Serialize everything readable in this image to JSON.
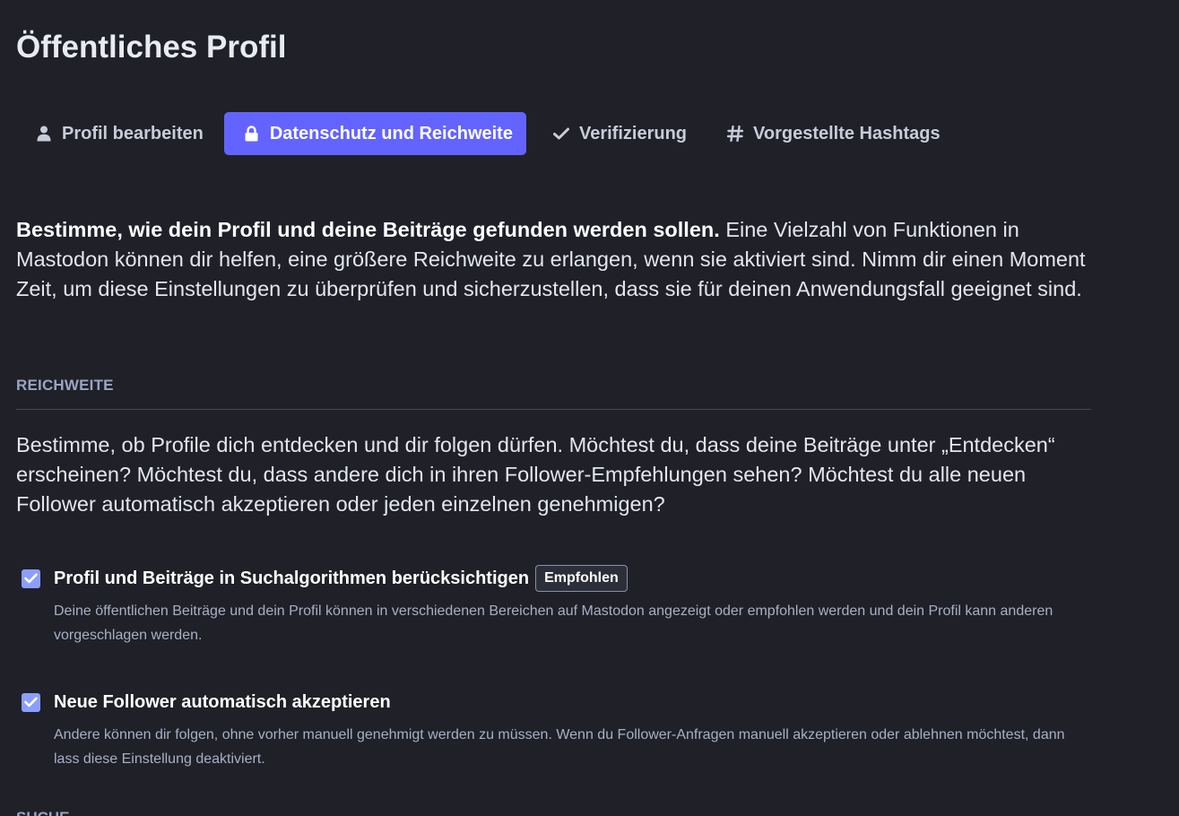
{
  "page": {
    "title": "Öffentliches Profil"
  },
  "tabs": [
    {
      "label": "Profil bearbeiten",
      "icon": "user-icon",
      "active": false
    },
    {
      "label": "Datenschutz und Reichweite",
      "icon": "lock-icon",
      "active": true
    },
    {
      "label": "Verifizierung",
      "icon": "check-icon",
      "active": false
    },
    {
      "label": "Vorgestellte Hashtags",
      "icon": "hashtag-icon",
      "active": false
    }
  ],
  "intro": {
    "bold": "Bestimme, wie dein Profil und deine Beiträge gefunden werden sollen.",
    "text": " Eine Vielzahl von Funktionen in Mastodon können dir helfen, eine größere Reichweite zu erlangen, wenn sie aktiviert sind. Nimm dir einen Moment Zeit, um diese Einstellungen zu überprüfen und sicherzustellen, dass sie für deinen Anwendungsfall geeignet sind."
  },
  "reach": {
    "heading": "REICHWEITE",
    "intro": "Bestimme, ob Profile dich entdecken und dir folgen dürfen. Möchtest du, dass deine Beiträge unter „Entdecken“ erscheinen? Möchtest du, dass andere dich in ihren Follower-Empfehlungen sehen? Möchtest du alle neuen Follower automatisch akzeptieren oder jeden einzelnen genehmigen?",
    "options": [
      {
        "label": "Profil und Beiträge in Suchalgorithmen berücksichtigen",
        "badge": "Empfohlen",
        "checked": true,
        "hint": "Deine öffentlichen Beiträge und dein Profil können in verschiedenen Bereichen auf Mastodon angezeigt oder empfohlen werden und dein Profil kann anderen vorgeschlagen werden."
      },
      {
        "label": "Neue Follower automatisch akzeptieren",
        "checked": true,
        "hint": "Andere können dir folgen, ohne vorher manuell genehmigt werden zu müssen. Wenn du Follower-Anfragen manuell akzeptieren oder ablehnen möchtest, dann lass diese Einstellung deaktiviert."
      }
    ]
  },
  "search": {
    "heading": "SUCHE"
  },
  "colors": {
    "background": "#1f2028",
    "accent": "#6364ff",
    "checkbox": "#8c9eff"
  }
}
